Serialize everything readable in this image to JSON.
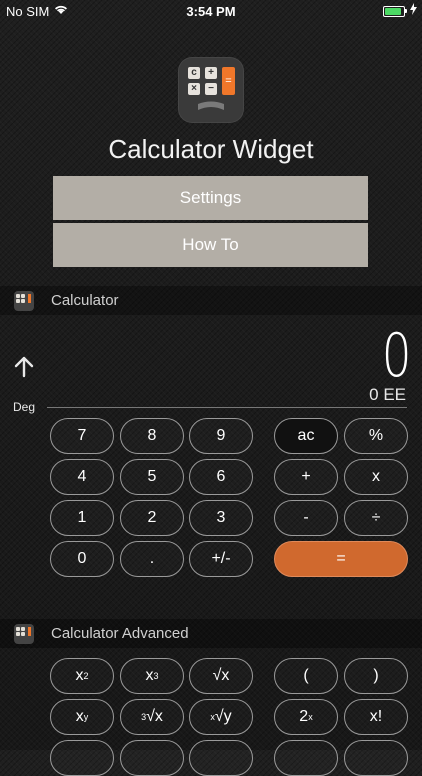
{
  "status_bar": {
    "carrier": "No SIM",
    "time": "3:54 PM",
    "battery_level": 1.0
  },
  "app": {
    "title": "Calculator Widget",
    "icon_keys": [
      "c",
      "+",
      "×",
      "−",
      "="
    ],
    "buttons": {
      "settings": "Settings",
      "how_to": "How To"
    }
  },
  "widget": {
    "title": "Calculator",
    "angle_mode": "Deg",
    "display": "0",
    "sub_display": "0 EE",
    "keys": [
      [
        "7",
        "8",
        "9",
        "ac",
        "%"
      ],
      [
        "4",
        "5",
        "6",
        "+",
        "x"
      ],
      [
        "1",
        "2",
        "3",
        "-",
        "÷"
      ],
      [
        "0",
        ".",
        "+/-",
        "="
      ]
    ]
  },
  "advanced": {
    "title": "Calculator Advanced",
    "row1": {
      "square_base": "x",
      "square_exp": "2",
      "cube_base": "x",
      "cube_exp": "3",
      "sqrt": "√x",
      "lparen": "(",
      "rparen": ")"
    },
    "row2": {
      "pow_base": "x",
      "pow_exp": "y",
      "cbrt_idx": "3",
      "cbrt_body": "√x",
      "yroot_idx": "x",
      "yroot_body": "√y",
      "twopow_base": "2",
      "twopow_exp": "x",
      "factorial": "x!"
    }
  },
  "colors": {
    "accent": "#d0692e",
    "menu_button": "#b3aea6",
    "battery": "#4cd964"
  }
}
